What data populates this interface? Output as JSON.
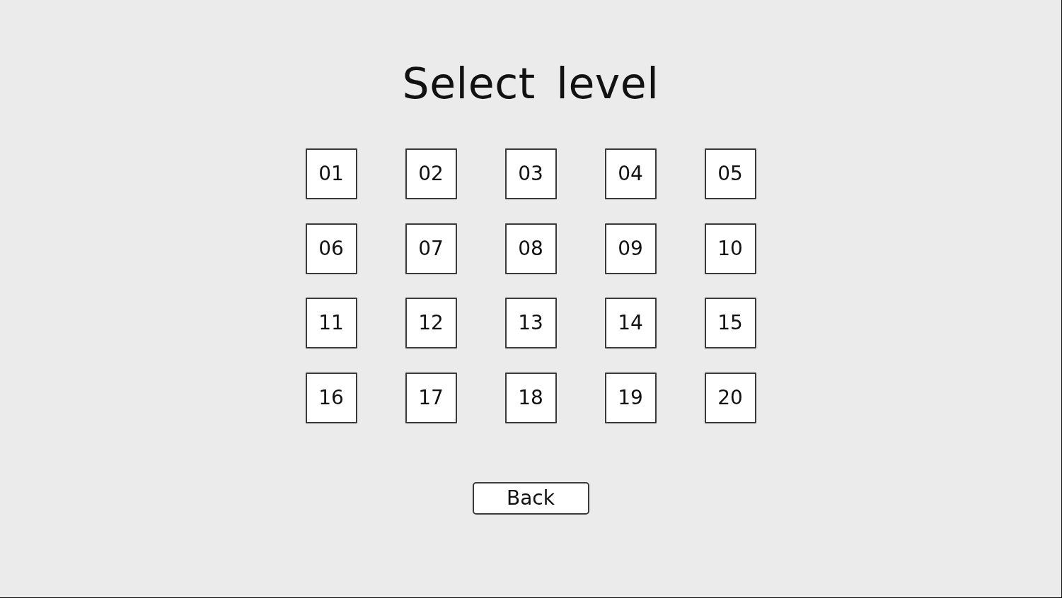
{
  "screen": {
    "title": "Select level"
  },
  "levels": [
    {
      "label": "01"
    },
    {
      "label": "02"
    },
    {
      "label": "03"
    },
    {
      "label": "04"
    },
    {
      "label": "05"
    },
    {
      "label": "06"
    },
    {
      "label": "07"
    },
    {
      "label": "08"
    },
    {
      "label": "09"
    },
    {
      "label": "10"
    },
    {
      "label": "11"
    },
    {
      "label": "12"
    },
    {
      "label": "13"
    },
    {
      "label": "14"
    },
    {
      "label": "15"
    },
    {
      "label": "16"
    },
    {
      "label": "17"
    },
    {
      "label": "18"
    },
    {
      "label": "19"
    },
    {
      "label": "20"
    }
  ],
  "back_button": {
    "label": "Back"
  }
}
